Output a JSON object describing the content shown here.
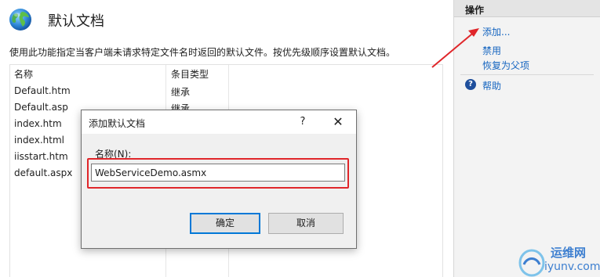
{
  "main": {
    "title": "默认文档",
    "description": "使用此功能指定当客户端未请求特定文件名时返回的默认文件。按优先级顺序设置默认文档。",
    "columns": [
      "名称",
      "条目类型"
    ],
    "rows": [
      {
        "name": "Default.htm",
        "type": "继承"
      },
      {
        "name": "Default.asp",
        "type": "继承"
      },
      {
        "name": "index.htm",
        "type": ""
      },
      {
        "name": "index.html",
        "type": ""
      },
      {
        "name": "iisstart.htm",
        "type": ""
      },
      {
        "name": "default.aspx",
        "type": ""
      }
    ]
  },
  "actions": {
    "header": "操作",
    "add": "添加...",
    "disable": "禁用",
    "revert": "恢复为父项",
    "help": "帮助",
    "help_icon": "question-circle-icon"
  },
  "dialog": {
    "title": "添加默认文档",
    "help_button": "?",
    "close_button": "✕",
    "name_label": "名称(N):",
    "name_value": "WebServiceDemo.asmx",
    "ok": "确定",
    "cancel": "取消"
  },
  "watermark": {
    "line1": "运维网",
    "line2": "iyunv.com"
  },
  "colors": {
    "link": "#1565c0",
    "highlight": "#e0262a",
    "primary_border": "#0078d7"
  }
}
